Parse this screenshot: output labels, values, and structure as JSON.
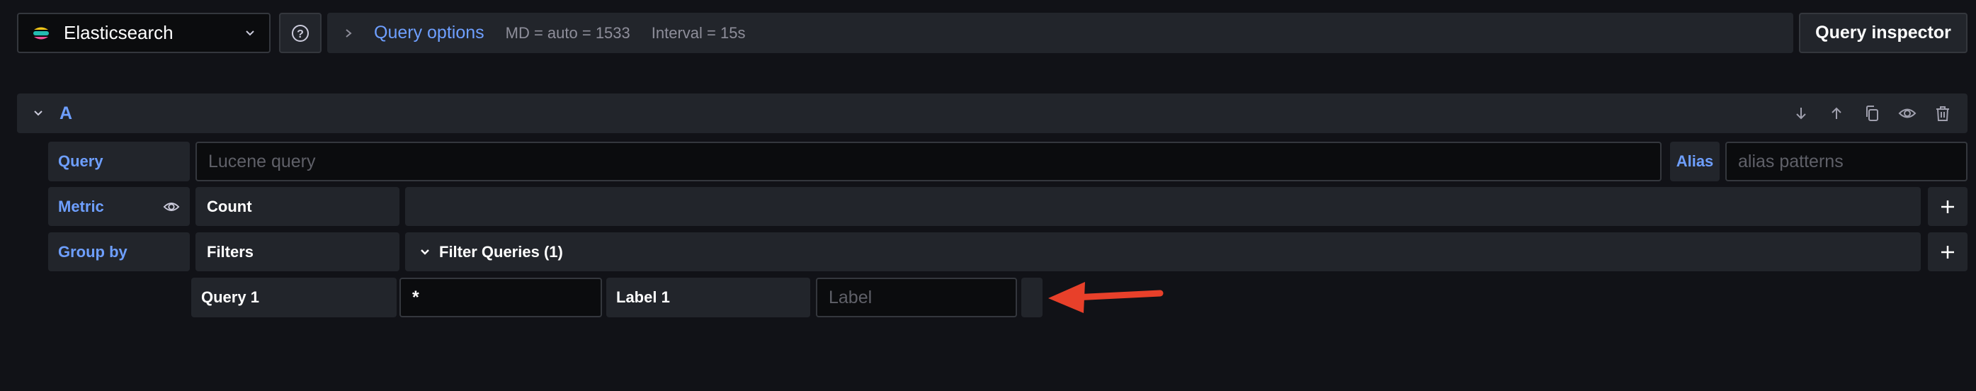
{
  "datasource": {
    "name": "Elasticsearch"
  },
  "query_options": {
    "label": "Query options",
    "md": "MD = auto = 1533",
    "interval": "Interval = 15s"
  },
  "inspector": {
    "label": "Query inspector"
  },
  "query_row": {
    "name": "A"
  },
  "fields": {
    "query_label": "Query",
    "query_placeholder": "Lucene query",
    "alias_label": "Alias",
    "alias_placeholder": "alias patterns",
    "metric_label": "Metric",
    "metric_value": "Count",
    "groupby_label": "Group by",
    "groupby_value": "Filters",
    "filter_queries_label": "Filter Queries (1)",
    "query1_label": "Query 1",
    "query1_value": "*",
    "label1_label": "Label 1",
    "label1_placeholder": "Label"
  },
  "colors": {
    "accent": "#6e9fff",
    "arrow": "#e8402a",
    "background": "#111217"
  },
  "icons": [
    "elasticsearch-logo-icon",
    "chevron-down-icon",
    "help-icon",
    "chevron-right-icon",
    "arrow-down-icon",
    "arrow-up-icon",
    "copy-icon",
    "eye-icon",
    "trash-icon",
    "plus-icon"
  ]
}
